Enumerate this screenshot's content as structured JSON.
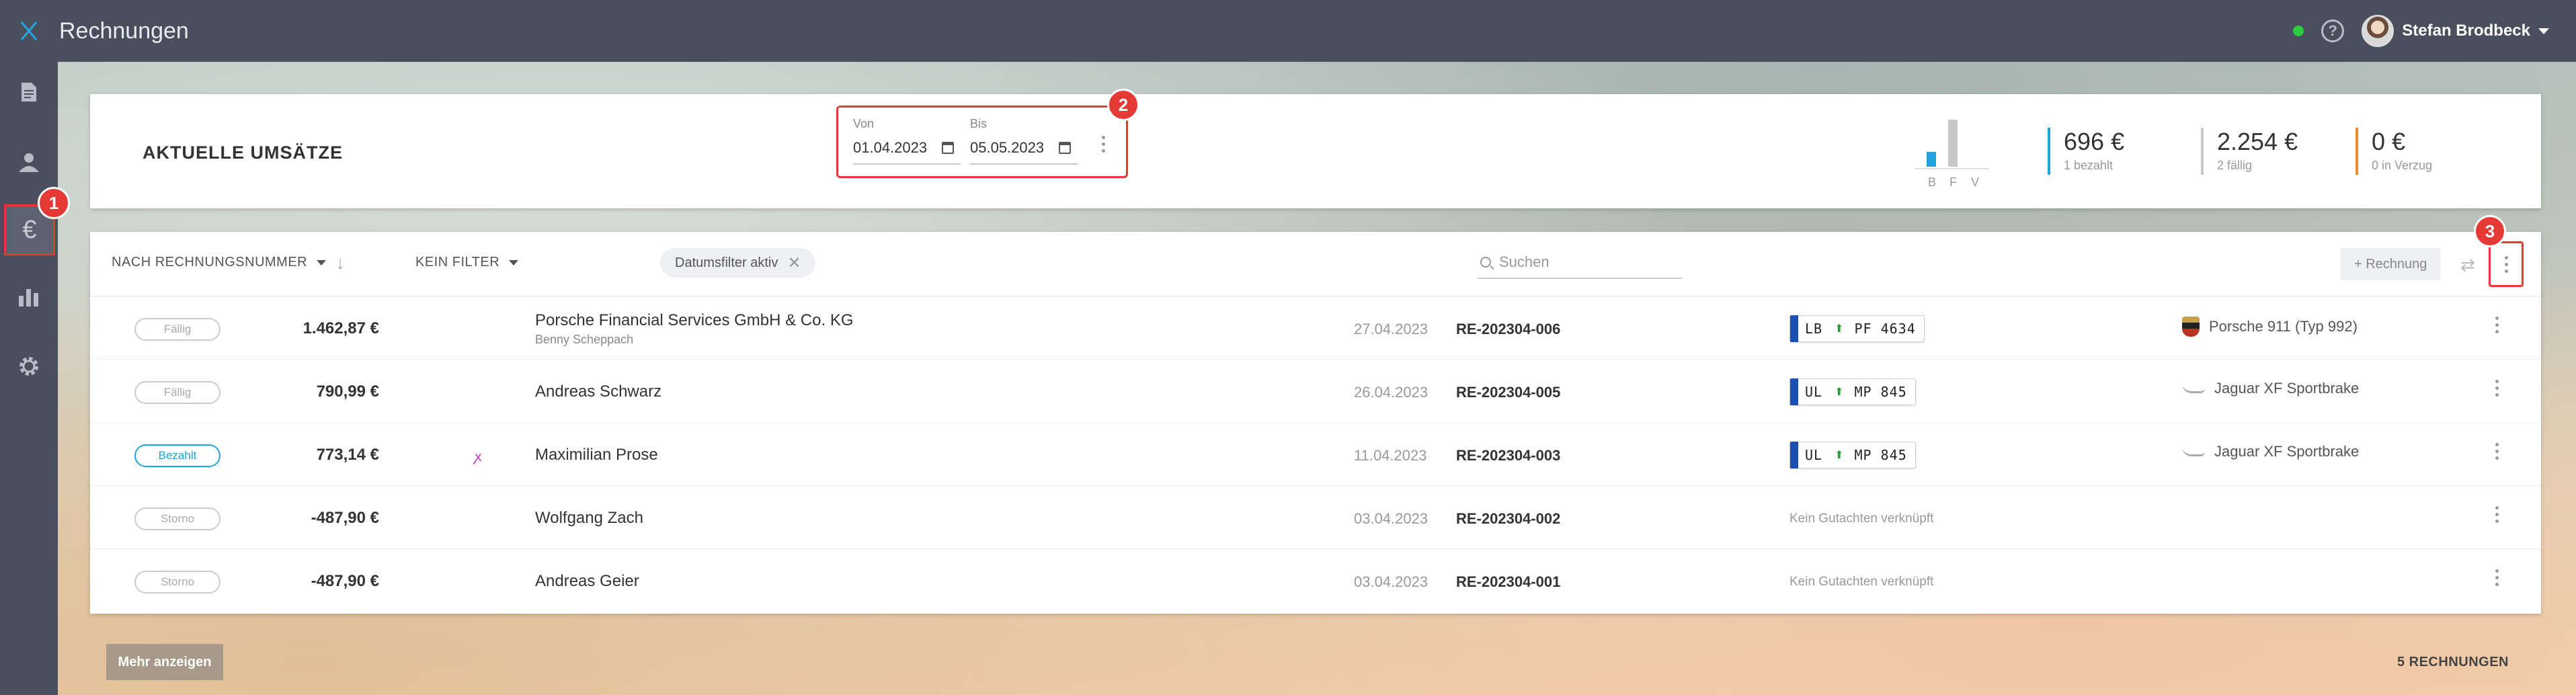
{
  "header": {
    "app_title": "Rechnungen",
    "user_name": "Stefan Brodbeck",
    "status_color": "#2ecc40",
    "help_glyph": "?"
  },
  "sidebar": {
    "items": [
      {
        "icon": "document-icon"
      },
      {
        "icon": "person-icon"
      },
      {
        "icon": "euro-icon",
        "glyph": "€",
        "active": true
      },
      {
        "icon": "bar-chart-icon"
      },
      {
        "icon": "gear-icon"
      }
    ]
  },
  "markers": [
    "1",
    "2",
    "3"
  ],
  "summary": {
    "title": "AKTUELLE UMSÄTZE",
    "date_from_label": "Von",
    "date_from": "01.04.2023",
    "date_to_label": "Bis",
    "date_to": "05.05.2023",
    "mini_chart": {
      "labels": [
        "B",
        "F",
        "V"
      ],
      "values": [
        696,
        2254,
        0
      ],
      "colors": [
        "#1fa4de",
        "#c8c8c8",
        "#f08a24"
      ]
    },
    "stats": [
      {
        "value": "696 €",
        "sub": "1 bezahlt",
        "color": "#1fa4de"
      },
      {
        "value": "2.254 €",
        "sub": "2 fällig",
        "color": "#c8c8c8"
      },
      {
        "value": "0 €",
        "sub": "0 in Verzug",
        "color": "#f08a24"
      }
    ]
  },
  "toolbar": {
    "sort_label": "NACH RECHNUNGSNUMMER",
    "filter_label": "KEIN FILTER",
    "chip_label": "Datumsfilter aktiv",
    "search_placeholder": "Suchen",
    "add_label": "+ Rechnung"
  },
  "invoices": [
    {
      "status": "Fällig",
      "amount": "1.462,87 €",
      "customer": "Porsche Financial Services GmbH & Co. KG",
      "contact": "Benny Scheppach",
      "date": "27.04.2023",
      "number": "RE-202304-006",
      "plate_left": "LB",
      "plate_right": "PF 4634",
      "car": "Porsche 911 (Typ 992)",
      "car_logo": "porsche"
    },
    {
      "status": "Fällig",
      "amount": "790,99 €",
      "customer": "Andreas Schwarz",
      "contact": "",
      "date": "26.04.2023",
      "number": "RE-202304-005",
      "plate_left": "UL",
      "plate_right": "MP 845",
      "car": "Jaguar XF Sportbrake",
      "car_logo": "jaguar"
    },
    {
      "status": "Bezahlt",
      "amount": "773,14 €",
      "customer": "Maximilian Prose",
      "contact": "",
      "date": "11.04.2023",
      "number": "RE-202304-003",
      "plate_left": "UL",
      "plate_right": "MP 845",
      "car": "Jaguar XF Sportbrake",
      "car_logo": "jaguar",
      "amount_icon": "ꭗ"
    },
    {
      "status": "Storno",
      "amount": "-487,90 €",
      "customer": "Wolfgang Zach",
      "contact": "",
      "date": "03.04.2023",
      "number": "RE-202304-002",
      "no_report": "Kein Gutachten verknüpft"
    },
    {
      "status": "Storno",
      "amount": "-487,90 €",
      "customer": "Andreas Geier",
      "contact": "",
      "date": "03.04.2023",
      "number": "RE-202304-001",
      "no_report": "Kein Gutachten verknüpft"
    }
  ],
  "footer": {
    "more_label": "Mehr anzeigen",
    "count_label": "5 RECHNUNGEN"
  }
}
